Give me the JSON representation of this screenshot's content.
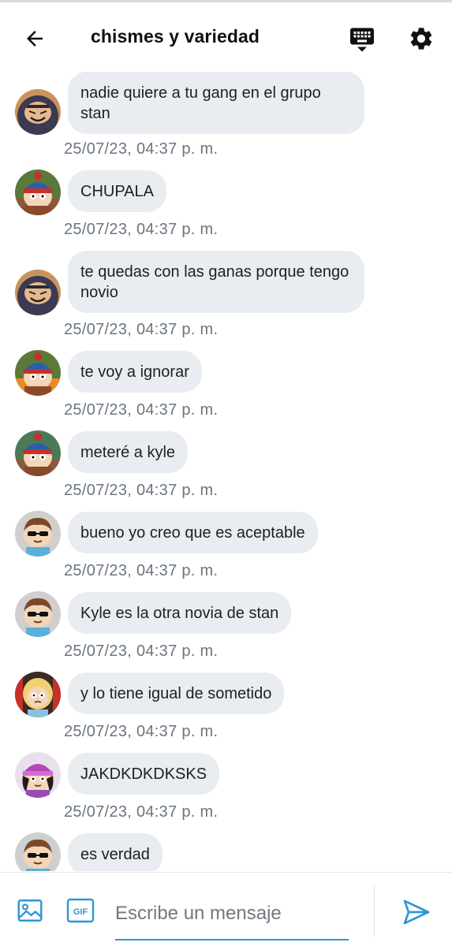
{
  "header": {
    "title": "chismes y variedad",
    "icons": [
      "back-arrow-icon",
      "keyboard-icon",
      "gear-icon"
    ]
  },
  "messages": [
    {
      "avatar": "hooded-character-avatar",
      "text": "nadie quiere a tu gang en el grupo stan",
      "time": "25/07/23, 04:37 p. m."
    },
    {
      "avatar": "red-pompom-hat-avatar",
      "text": "CHUPALA",
      "time": "25/07/23, 04:37 p. m."
    },
    {
      "avatar": "hooded-character-avatar",
      "text": "te quedas con las ganas porque tengo novio",
      "time": "25/07/23, 04:37 p. m."
    },
    {
      "avatar": "red-pompom-hat-avatar",
      "text": "te voy a ignorar",
      "time": "25/07/23, 04:37 p. m."
    },
    {
      "avatar": "red-pompom-hat-avatar",
      "text": "meteré a kyle",
      "time": "25/07/23, 04:37 p. m."
    },
    {
      "avatar": "sunglasses-character-avatar",
      "text": "bueno yo creo que es aceptable",
      "time": "25/07/23, 04:37 p. m."
    },
    {
      "avatar": "sunglasses-character-avatar",
      "text": "Kyle es la otra novia de stan",
      "time": "25/07/23, 04:37 p. m."
    },
    {
      "avatar": "blonde-character-avatar",
      "text": "y lo tiene igual de sometido",
      "time": "25/07/23, 04:37 p. m."
    },
    {
      "avatar": "purple-hat-character-avatar",
      "text": "JAKDKDKDKSKS",
      "time": "25/07/23, 04:37 p. m."
    },
    {
      "avatar": "sunglasses-character-avatar",
      "text": "es verdad",
      "time": ""
    }
  ],
  "composer": {
    "placeholder": "Escribe un mensaje",
    "gif_label": "GIF",
    "icons": [
      "image-icon",
      "gif-icon",
      "send-icon"
    ]
  },
  "colors": {
    "bubble": "#e9edf1",
    "accent": "#2d97d5",
    "timestamp": "#6b7580"
  }
}
